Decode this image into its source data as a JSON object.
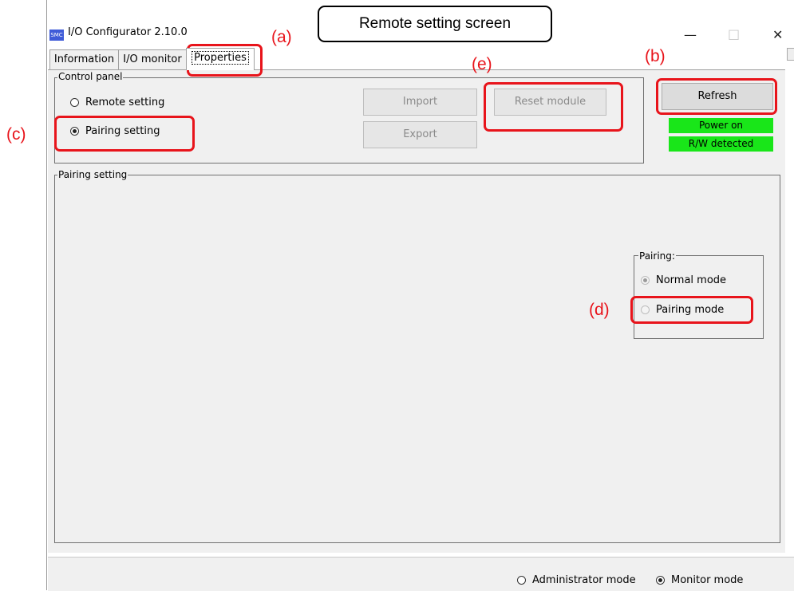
{
  "callout": "Remote setting screen",
  "annotations": {
    "a": "(a)",
    "b": "(b)",
    "c": "(c)",
    "d": "(d)",
    "e": "(e)"
  },
  "window": {
    "title": "I/O Configurator 2.10.0",
    "icon": "smc-app-icon",
    "minimize": "—",
    "maximize": "□",
    "close": "✕"
  },
  "tabs": [
    "Information",
    "I/O monitor",
    "Properties"
  ],
  "control_panel": {
    "legend": "Control panel",
    "radios": [
      {
        "label": "Remote setting",
        "checked": false
      },
      {
        "label": "Pairing setting",
        "checked": true
      }
    ],
    "import_label": "Import",
    "export_label": "Export",
    "reset_label": "Reset module"
  },
  "refresh_label": "Refresh",
  "status": {
    "power": "Power on",
    "rw": "R/W detected"
  },
  "pairing_setting": {
    "legend": "Pairing setting",
    "pairing_group": {
      "legend": "Pairing:",
      "normal_label": "Normal mode",
      "pairing_label": "Pairing mode",
      "selected": "Normal mode"
    }
  },
  "footer": {
    "admin_label": "Administrator mode",
    "monitor_label": "Monitor mode",
    "selected": "Monitor mode"
  },
  "colors": {
    "annotation_red": "#e8141b",
    "status_green": "#19e619",
    "panel_bg": "#f0f0f0"
  }
}
